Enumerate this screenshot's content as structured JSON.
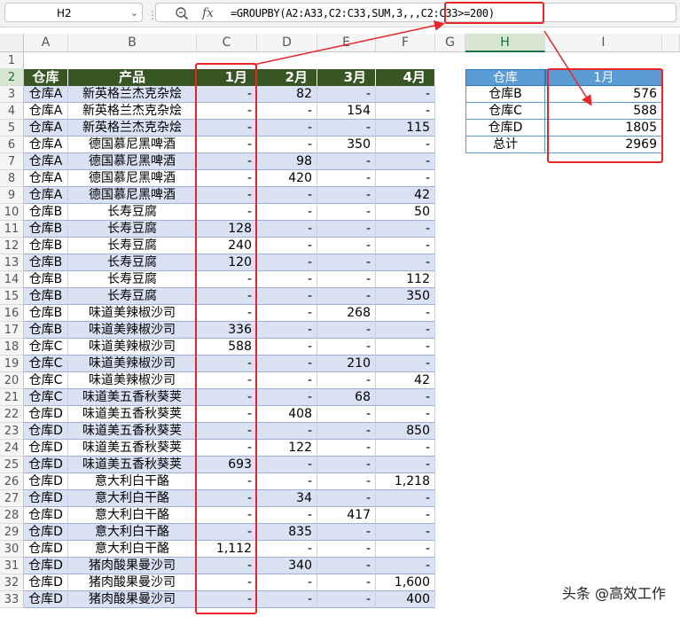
{
  "formula_bar": {
    "name_box": "H2",
    "fx_label": "fx",
    "formula_text": "=GROUPBY(A2:A33,C2:C33,SUM,3,,,C2:C33>=200)"
  },
  "columns": [
    "A",
    "B",
    "C",
    "D",
    "E",
    "F",
    "G",
    "H",
    "I"
  ],
  "rows": [
    "1",
    "2",
    "3",
    "4",
    "5",
    "6",
    "7",
    "8",
    "9",
    "10",
    "11",
    "12",
    "13",
    "14",
    "15",
    "16",
    "17",
    "18",
    "19",
    "20",
    "21",
    "22",
    "23",
    "24",
    "25",
    "26",
    "27",
    "28",
    "29",
    "30",
    "31",
    "32",
    "33"
  ],
  "table": {
    "headers": [
      "仓库",
      "产品",
      "1月",
      "2月",
      "3月",
      "4月"
    ],
    "rows": [
      [
        "仓库A",
        "新英格兰杰克杂烩",
        "-",
        "82",
        "-",
        "-"
      ],
      [
        "仓库A",
        "新英格兰杰克杂烩",
        "-",
        "-",
        "154",
        "-"
      ],
      [
        "仓库A",
        "新英格兰杰克杂烩",
        "-",
        "-",
        "-",
        "115"
      ],
      [
        "仓库A",
        "德国慕尼黑啤酒",
        "-",
        "-",
        "350",
        "-"
      ],
      [
        "仓库A",
        "德国慕尼黑啤酒",
        "-",
        "98",
        "-",
        "-"
      ],
      [
        "仓库A",
        "德国慕尼黑啤酒",
        "-",
        "420",
        "-",
        "-"
      ],
      [
        "仓库A",
        "德国慕尼黑啤酒",
        "-",
        "-",
        "-",
        "42"
      ],
      [
        "仓库B",
        "长寿豆腐",
        "-",
        "-",
        "-",
        "50"
      ],
      [
        "仓库B",
        "长寿豆腐",
        "128",
        "-",
        "-",
        "-"
      ],
      [
        "仓库B",
        "长寿豆腐",
        "240",
        "-",
        "-",
        "-"
      ],
      [
        "仓库B",
        "长寿豆腐",
        "120",
        "-",
        "-",
        "-"
      ],
      [
        "仓库B",
        "长寿豆腐",
        "-",
        "-",
        "-",
        "112"
      ],
      [
        "仓库B",
        "长寿豆腐",
        "-",
        "-",
        "-",
        "350"
      ],
      [
        "仓库B",
        "味道美辣椒沙司",
        "-",
        "-",
        "268",
        "-"
      ],
      [
        "仓库B",
        "味道美辣椒沙司",
        "336",
        "-",
        "-",
        "-"
      ],
      [
        "仓库C",
        "味道美辣椒沙司",
        "588",
        "-",
        "-",
        "-"
      ],
      [
        "仓库C",
        "味道美辣椒沙司",
        "-",
        "-",
        "210",
        "-"
      ],
      [
        "仓库C",
        "味道美辣椒沙司",
        "-",
        "-",
        "-",
        "42"
      ],
      [
        "仓库C",
        "味道美五香秋葵荚",
        "-",
        "-",
        "68",
        "-"
      ],
      [
        "仓库D",
        "味道美五香秋葵荚",
        "-",
        "408",
        "-",
        "-"
      ],
      [
        "仓库D",
        "味道美五香秋葵荚",
        "-",
        "-",
        "-",
        "850"
      ],
      [
        "仓库D",
        "味道美五香秋葵荚",
        "-",
        "122",
        "-",
        "-"
      ],
      [
        "仓库D",
        "味道美五香秋葵荚",
        "693",
        "-",
        "-",
        "-"
      ],
      [
        "仓库D",
        "意大利白干酪",
        "-",
        "-",
        "-",
        "1,218"
      ],
      [
        "仓库D",
        "意大利白干酪",
        "-",
        "34",
        "-",
        "-"
      ],
      [
        "仓库D",
        "意大利白干酪",
        "-",
        "-",
        "417",
        "-"
      ],
      [
        "仓库D",
        "意大利白干酪",
        "-",
        "835",
        "-",
        "-"
      ],
      [
        "仓库D",
        "意大利白干酪",
        "1,112",
        "-",
        "-",
        "-"
      ],
      [
        "仓库D",
        "猪肉酸果曼沙司",
        "-",
        "340",
        "-",
        "-"
      ],
      [
        "仓库D",
        "猪肉酸果曼沙司",
        "-",
        "-",
        "-",
        "1,600"
      ],
      [
        "仓库D",
        "猪肉酸果曼沙司",
        "-",
        "-",
        "-",
        "400"
      ]
    ]
  },
  "result": {
    "headers": [
      "仓库",
      "1月"
    ],
    "rows": [
      [
        "仓库B",
        "576"
      ],
      [
        "仓库C",
        "588"
      ],
      [
        "仓库D",
        "1805"
      ],
      [
        "总计",
        "2969"
      ]
    ]
  },
  "watermark": "头条 @高效工作",
  "colors": {
    "header_green": "#375623",
    "band_blue": "#d9e1f2",
    "result_header": "#5b9bd5",
    "annotation_red": "#e8262a"
  }
}
